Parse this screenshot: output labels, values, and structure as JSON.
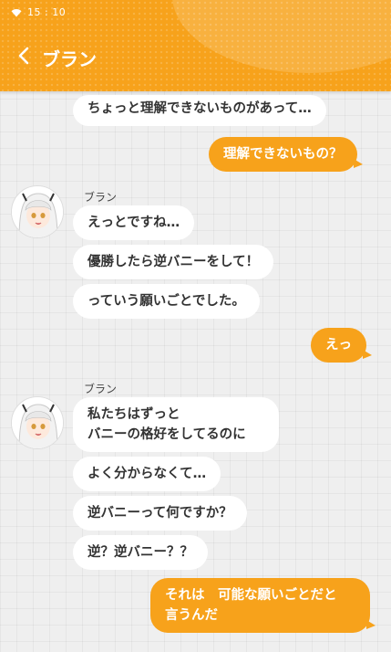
{
  "status_bar": {
    "time": "15 : 10"
  },
  "header": {
    "title": "ブラン"
  },
  "messages": {
    "m0": "ちょっと理解できないものがあって…",
    "m1": "理解できないもの？",
    "name1": "ブラン",
    "m2": "えっとですね…",
    "m3": "優勝したら逆バニーをして！",
    "m4": "っていう願いごとでした。",
    "m5": "えっ",
    "name2": "ブラン",
    "m6_line1": "私たちはずっと",
    "m6_line2": "バニーの格好をしてるのに",
    "m7": "よく分からなくて…",
    "m8": "逆バニーって何ですか？",
    "m9": "逆？逆バニー？？",
    "m10_line1": "それは　可能な願いごとだと",
    "m10_line2": "言うんだ"
  },
  "colors": {
    "accent": "#f7a21b",
    "incoming_bubble": "#ffffff",
    "background": "#efefef"
  }
}
